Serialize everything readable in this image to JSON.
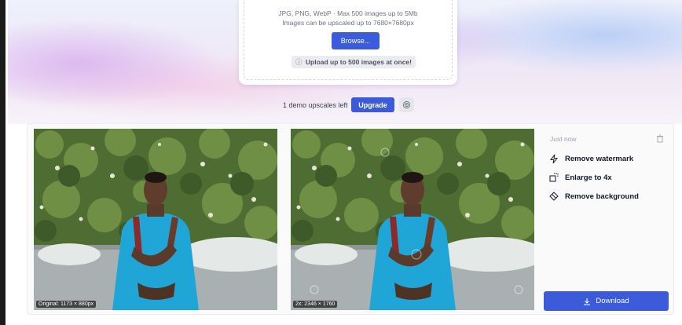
{
  "upload": {
    "formats_line": "JPG, PNG, WebP · Max 500 images up to 5Mb",
    "size_line": "Images can be upscaled up to 7680×7680px",
    "browse_label": "Browse...",
    "bulk_notice": "Upload up to 500 images at once!"
  },
  "demo_bar": {
    "status_text": "1 demo upscales left",
    "upgrade_label": "Upgrade"
  },
  "result": {
    "original_label": "Original: 1173 × 880px",
    "upscaled_label": "2x: 2346 × 1760",
    "timestamp": "Just now",
    "actions": [
      {
        "label": "Remove watermark",
        "icon": "lightning-icon"
      },
      {
        "label": "Enlarge to 4x",
        "icon": "enlarge-icon"
      },
      {
        "label": "Remove background",
        "icon": "eraser-icon"
      }
    ],
    "download_label": "Download"
  },
  "colors": {
    "accent": "#3b5bdb",
    "panel": "#fafafa"
  }
}
